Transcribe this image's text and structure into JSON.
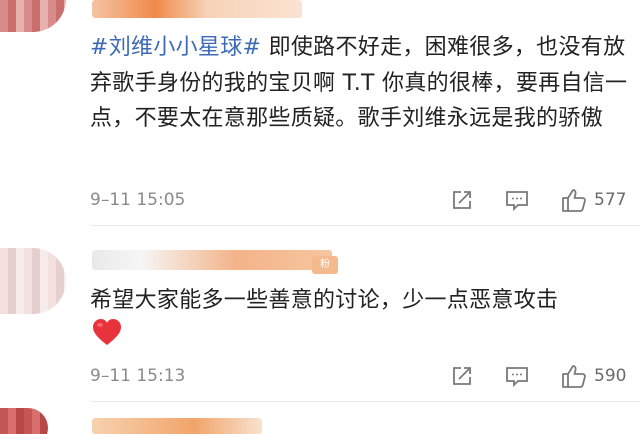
{
  "comments": [
    {
      "hashtag": "#刘维小小星球#",
      "text": " 即使路不好走，困难很多，也没有放弃歌手身份的我的宝贝啊 T.T 你真的很棒，要再自信一点，不要太在意那些质疑。歌手刘维永远是我的骄傲",
      "time": "9–11 15:05",
      "likes": "577"
    },
    {
      "badge": "粉",
      "text": "希望大家能多一些善意的讨论，少一点恶意攻击",
      "emoji": "heart",
      "time": "9–11 15:13",
      "likes": "590"
    }
  ],
  "icons": {
    "share": "share-icon",
    "reply": "comment-icon",
    "like": "thumbs-up-icon"
  },
  "colors": {
    "hashtag": "#3d6ab8",
    "meta": "#8a8a8a",
    "heart": "#e8323c"
  }
}
